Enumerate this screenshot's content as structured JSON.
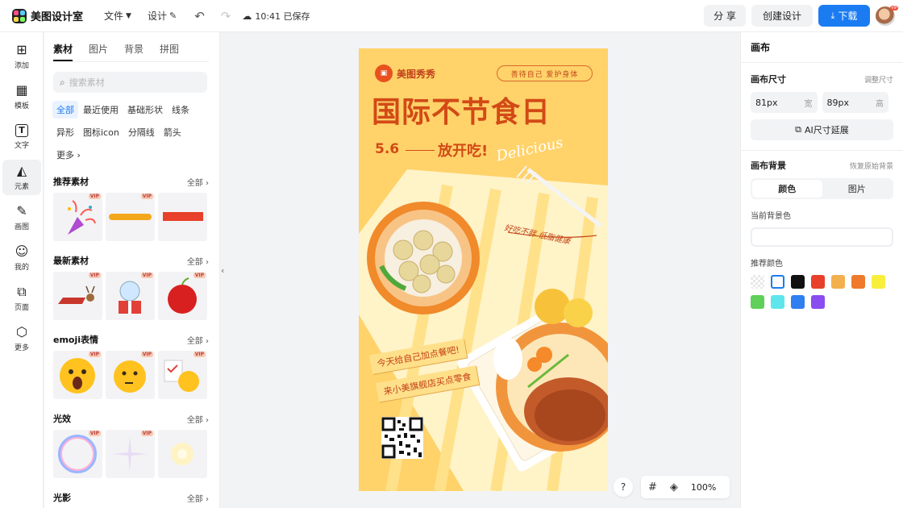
{
  "app": {
    "name": "美图设计室",
    "menu": {
      "file": "文件",
      "design": "设计"
    },
    "save_status": "10:41 已保存",
    "buttons": {
      "share": "分 享",
      "create": "创建设计",
      "download": "下载"
    },
    "avatar_badge": "VIP"
  },
  "rail": [
    {
      "label": "添加",
      "icon": "plus-square-icon"
    },
    {
      "label": "模板",
      "icon": "template-icon"
    },
    {
      "label": "文字",
      "icon": "text-icon"
    },
    {
      "label": "元素",
      "icon": "shapes-icon",
      "active": true
    },
    {
      "label": "画图",
      "icon": "draw-icon"
    },
    {
      "label": "我的",
      "icon": "user-icon"
    },
    {
      "label": "页面",
      "icon": "pages-icon"
    },
    {
      "label": "更多",
      "icon": "cube-icon"
    }
  ],
  "panel": {
    "tabs": [
      "素材",
      "图片",
      "背景",
      "拼图"
    ],
    "search_placeholder": "搜索素材",
    "chips": [
      "全部",
      "最近使用",
      "基础形状",
      "线条",
      "异形",
      "图标icon",
      "分隔线",
      "箭头",
      "更多"
    ],
    "all_label": "全部",
    "vip": "VIP",
    "sections": [
      "推荐素材",
      "最新素材",
      "emoji表情",
      "光效",
      "光影"
    ]
  },
  "poster": {
    "brand": "美图秀秀",
    "slogan": "善待自己  爱护身体",
    "title": "国际不节食日",
    "date": "5.6",
    "subtitle": "放开吃!",
    "script_text": "Delicious",
    "handwriting": "好吃不胖 低脂健康",
    "banner1": "今天给自己加点餐吧!",
    "banner2": "来小美旗舰店买点零食"
  },
  "canvas_tools": {
    "help": "?",
    "zoom": "100%"
  },
  "props": {
    "header": "画布",
    "size_label": "画布尺寸",
    "size_link": "调整尺寸",
    "width": {
      "value": "81px",
      "unit": "宽"
    },
    "height": {
      "value": "89px",
      "unit": "高"
    },
    "ai_button": "AI尺寸延展",
    "bg_label": "画布背景",
    "bg_link": "恢复原始背景",
    "bg_tabs": [
      "颜色",
      "图片"
    ],
    "current_bg_label": "当前背景色",
    "recommended_label": "推荐颜色",
    "colors": [
      "transparent",
      "#ffffff",
      "#111111",
      "#e8402a",
      "#f3b04e",
      "#ef7a2d",
      "#f7ef3b",
      "#5fd05a",
      "#5ee6ec",
      "#2f7ff0",
      "#8a4df0"
    ]
  }
}
